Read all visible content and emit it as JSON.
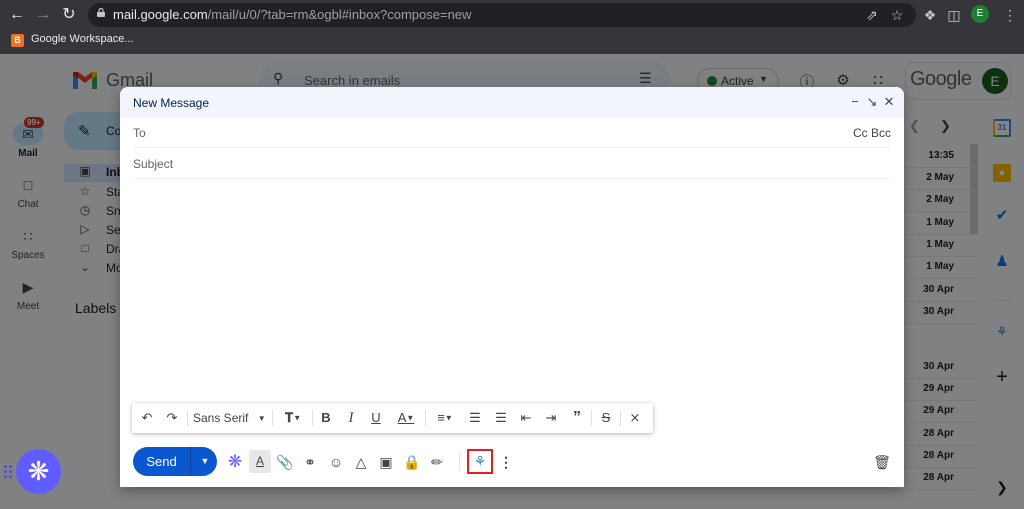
{
  "browser": {
    "url_host": "mail.google.com",
    "url_path": "/mail/u/0/?tab=rm&ogbl#inbox?compose=new",
    "profile_initial": "E",
    "bookmarks": [
      {
        "label": "Google Workspace...",
        "icon": "blogger-icon"
      }
    ],
    "icons": [
      "back-icon",
      "forward-icon",
      "reload-icon",
      "lock-icon",
      "share-icon",
      "star-icon",
      "extensions-icon",
      "side-panel-icon",
      "profile-avatar",
      "menu-icon"
    ]
  },
  "gmail": {
    "app_name": "Gmail",
    "search_placeholder": "Search in emails",
    "status": {
      "label": "Active",
      "color": "#1e8e3e"
    },
    "google_word": "Google",
    "account_initial": "E",
    "rail": [
      {
        "label": "Mail",
        "badge": "99+",
        "icon": "mail-icon"
      },
      {
        "label": "Chat",
        "icon": "chat-icon"
      },
      {
        "label": "Spaces",
        "icon": "spaces-icon"
      },
      {
        "label": "Meet",
        "icon": "meet-icon"
      }
    ],
    "compose_label": "Co",
    "nav": [
      {
        "label": "Inb",
        "icon": "inbox-icon"
      },
      {
        "label": "Sta",
        "icon": "star-icon"
      },
      {
        "label": "Sno",
        "icon": "snooze-icon"
      },
      {
        "label": "Se",
        "icon": "sent-icon"
      },
      {
        "label": "Dra",
        "icon": "draft-icon"
      },
      {
        "label": "Mo",
        "icon": "chevron-down-icon"
      }
    ],
    "labels_title": "Labels",
    "dates": [
      "13:35",
      "2 May",
      "2 May",
      "1 May",
      "1 May",
      "1 May",
      "30 Apr",
      "30 Apr",
      "30 Apr",
      "29 Apr",
      "29 Apr",
      "28 Apr",
      "28 Apr",
      "28 Apr"
    ],
    "side_apps": [
      {
        "name": "calendar",
        "text": "31"
      },
      {
        "name": "keep",
        "text": ""
      },
      {
        "name": "tasks",
        "text": ""
      },
      {
        "name": "contacts",
        "text": ""
      },
      {
        "name": "addon",
        "text": ""
      }
    ]
  },
  "compose": {
    "title": "New Message",
    "to_label": "To",
    "to_value": "",
    "cc_bcc": "Cc Bcc",
    "subject_placeholder": "Subject",
    "subject_value": "",
    "font_name": "Sans Serif",
    "send_label": "Send",
    "highlighted_addon": "addon-icon",
    "accent_color": "#0b57d0"
  }
}
